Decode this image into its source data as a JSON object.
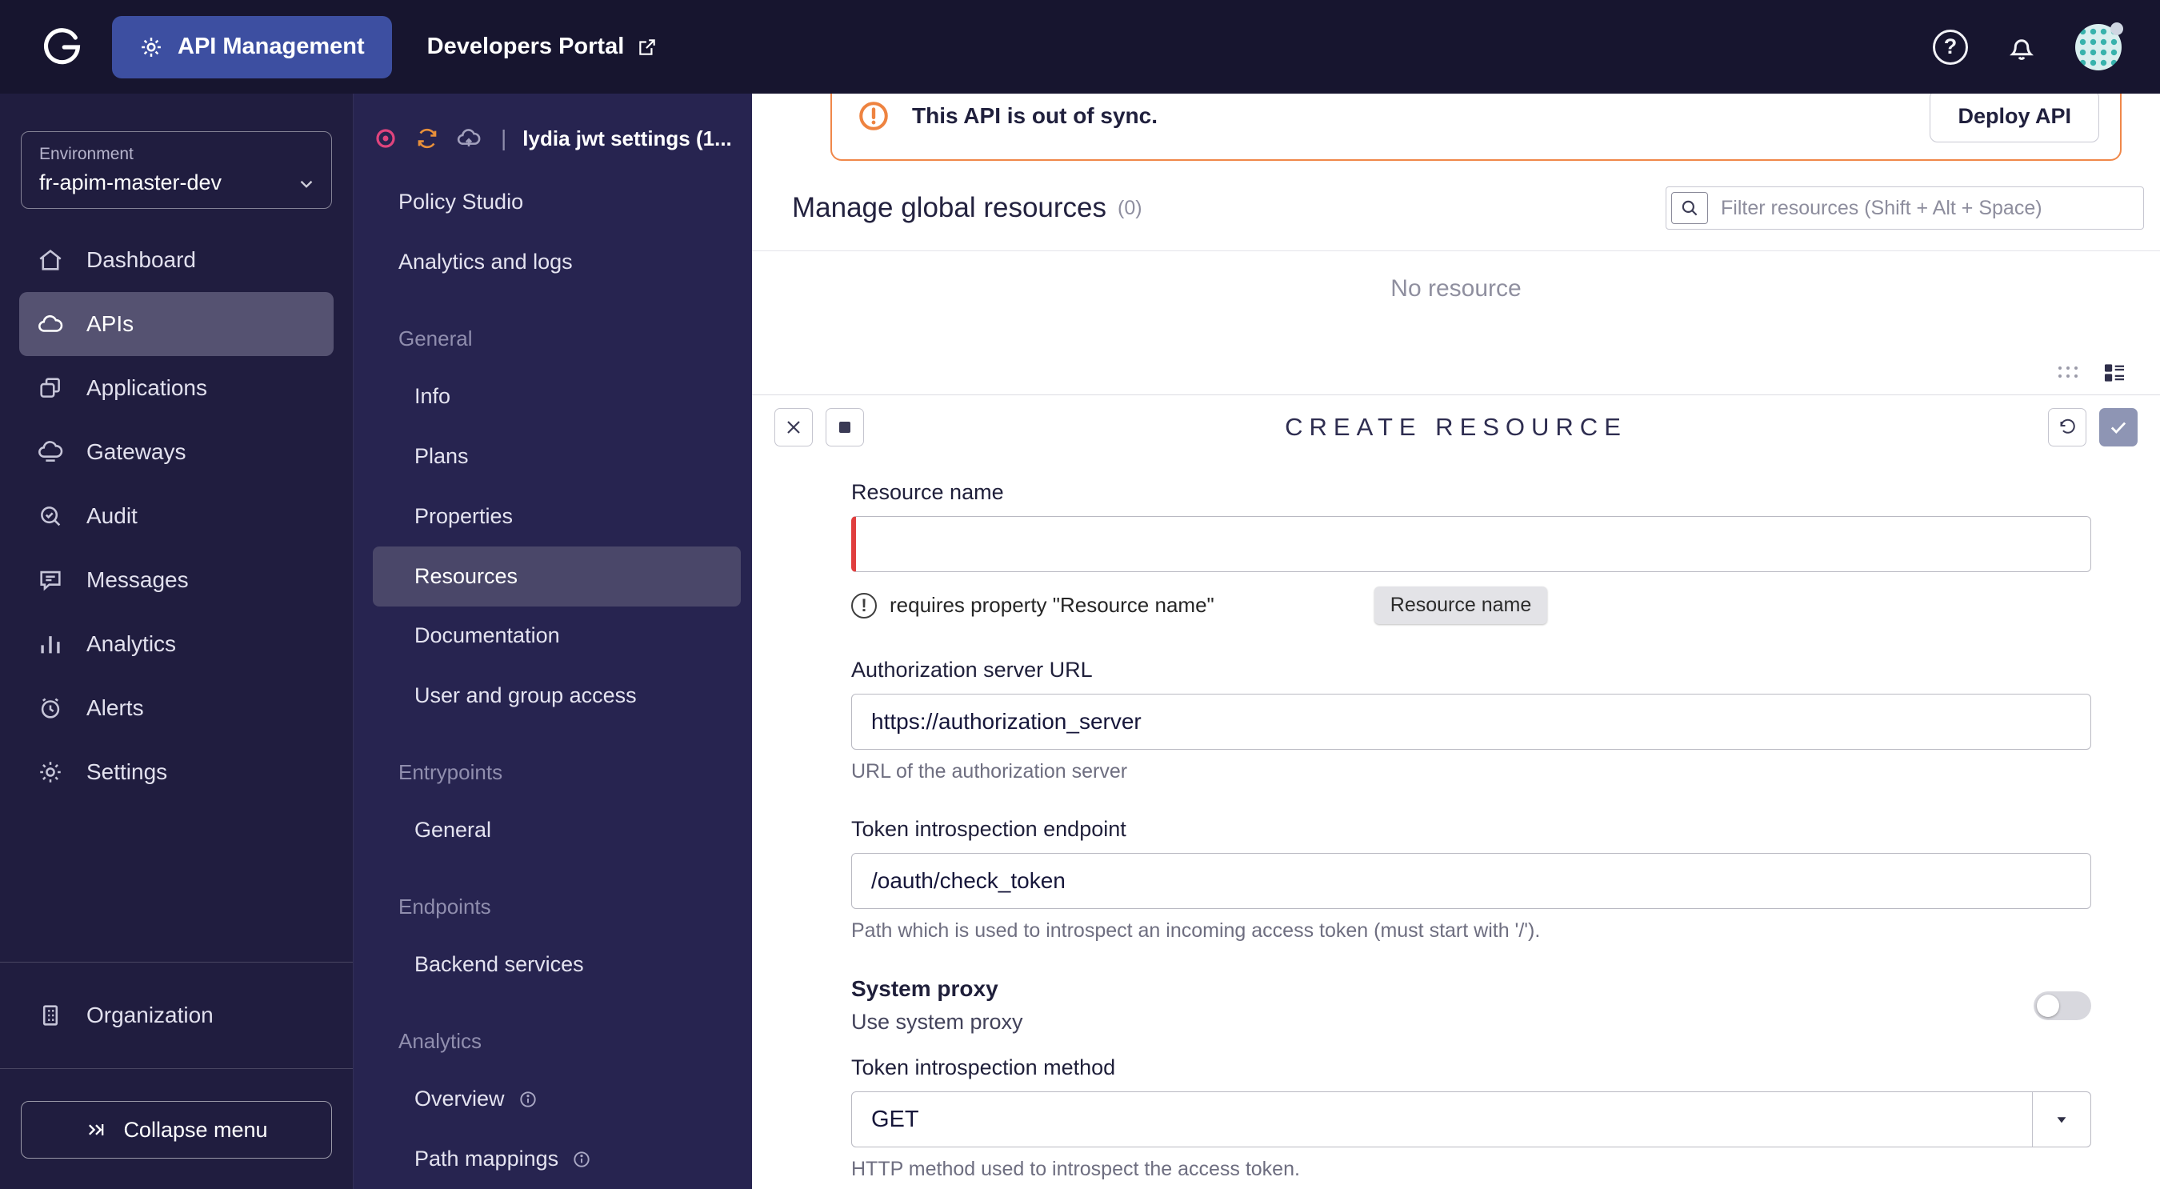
{
  "topbar": {
    "app_label": "API Management",
    "portal_label": "Developers Portal"
  },
  "sidebar": {
    "environment_label": "Environment",
    "environment_value": "fr-apim-master-dev",
    "items": [
      {
        "label": "Dashboard"
      },
      {
        "label": "APIs"
      },
      {
        "label": "Applications"
      },
      {
        "label": "Gateways"
      },
      {
        "label": "Audit"
      },
      {
        "label": "Messages"
      },
      {
        "label": "Analytics"
      },
      {
        "label": "Alerts"
      },
      {
        "label": "Settings"
      }
    ],
    "organization_label": "Organization",
    "collapse_label": "Collapse menu"
  },
  "api_nav": {
    "title": "lydia jwt settings (1...",
    "top": [
      "Policy Studio",
      "Analytics and logs"
    ],
    "sections": [
      {
        "title": "General",
        "items": [
          "Info",
          "Plans",
          "Properties",
          "Resources",
          "Documentation",
          "User and group access"
        ]
      },
      {
        "title": "Entrypoints",
        "items": [
          "General"
        ]
      },
      {
        "title": "Endpoints",
        "items": [
          "Backend services"
        ]
      },
      {
        "title": "Analytics",
        "items": [
          "Overview",
          "Path mappings"
        ]
      }
    ]
  },
  "banner": {
    "text": "This API is out of sync.",
    "deploy_label": "Deploy API"
  },
  "resources": {
    "heading": "Manage global resources",
    "count": "(0)",
    "filter_placeholder": "Filter resources (Shift + Alt + Space)",
    "empty_text": "No resource"
  },
  "create": {
    "title": "CREATE RESOURCE",
    "resource_name": {
      "label": "Resource name",
      "value": "",
      "error_text": "requires property \"Resource name\"",
      "error_chip": "Resource name"
    },
    "auth_url": {
      "label": "Authorization server URL",
      "value": "https://authorization_server",
      "hint": "URL of the authorization server"
    },
    "introspection_endpoint": {
      "label": "Token introspection endpoint",
      "value": "/oauth/check_token",
      "hint": "Path which is used to introspect an incoming access token (must start with '/')."
    },
    "system_proxy": {
      "label": "System proxy",
      "sublabel": "Use system proxy"
    },
    "introspection_method": {
      "label": "Token introspection method",
      "value": "GET",
      "hint": "HTTP method used to introspect the access token."
    }
  },
  "colors": {
    "topbar_bg": "#17152f",
    "sidebar_bg": "#201d3f",
    "api_sidebar_bg": "#272450",
    "brand_pill": "#3d4fa1",
    "warning_orange": "#f0884a",
    "error_red": "#e03e3e",
    "active_item": "#555271"
  }
}
